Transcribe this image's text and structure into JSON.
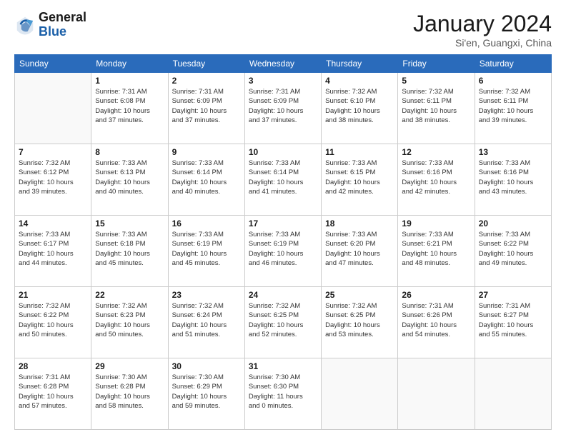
{
  "header": {
    "logo_general": "General",
    "logo_blue": "Blue",
    "title": "January 2024",
    "location": "Si'en, Guangxi, China"
  },
  "days_of_week": [
    "Sunday",
    "Monday",
    "Tuesday",
    "Wednesday",
    "Thursday",
    "Friday",
    "Saturday"
  ],
  "weeks": [
    [
      {
        "day": "",
        "info": ""
      },
      {
        "day": "1",
        "info": "Sunrise: 7:31 AM\nSunset: 6:08 PM\nDaylight: 10 hours\nand 37 minutes."
      },
      {
        "day": "2",
        "info": "Sunrise: 7:31 AM\nSunset: 6:09 PM\nDaylight: 10 hours\nand 37 minutes."
      },
      {
        "day": "3",
        "info": "Sunrise: 7:31 AM\nSunset: 6:09 PM\nDaylight: 10 hours\nand 37 minutes."
      },
      {
        "day": "4",
        "info": "Sunrise: 7:32 AM\nSunset: 6:10 PM\nDaylight: 10 hours\nand 38 minutes."
      },
      {
        "day": "5",
        "info": "Sunrise: 7:32 AM\nSunset: 6:11 PM\nDaylight: 10 hours\nand 38 minutes."
      },
      {
        "day": "6",
        "info": "Sunrise: 7:32 AM\nSunset: 6:11 PM\nDaylight: 10 hours\nand 39 minutes."
      }
    ],
    [
      {
        "day": "7",
        "info": "Sunrise: 7:32 AM\nSunset: 6:12 PM\nDaylight: 10 hours\nand 39 minutes."
      },
      {
        "day": "8",
        "info": "Sunrise: 7:33 AM\nSunset: 6:13 PM\nDaylight: 10 hours\nand 40 minutes."
      },
      {
        "day": "9",
        "info": "Sunrise: 7:33 AM\nSunset: 6:14 PM\nDaylight: 10 hours\nand 40 minutes."
      },
      {
        "day": "10",
        "info": "Sunrise: 7:33 AM\nSunset: 6:14 PM\nDaylight: 10 hours\nand 41 minutes."
      },
      {
        "day": "11",
        "info": "Sunrise: 7:33 AM\nSunset: 6:15 PM\nDaylight: 10 hours\nand 42 minutes."
      },
      {
        "day": "12",
        "info": "Sunrise: 7:33 AM\nSunset: 6:16 PM\nDaylight: 10 hours\nand 42 minutes."
      },
      {
        "day": "13",
        "info": "Sunrise: 7:33 AM\nSunset: 6:16 PM\nDaylight: 10 hours\nand 43 minutes."
      }
    ],
    [
      {
        "day": "14",
        "info": "Sunrise: 7:33 AM\nSunset: 6:17 PM\nDaylight: 10 hours\nand 44 minutes."
      },
      {
        "day": "15",
        "info": "Sunrise: 7:33 AM\nSunset: 6:18 PM\nDaylight: 10 hours\nand 45 minutes."
      },
      {
        "day": "16",
        "info": "Sunrise: 7:33 AM\nSunset: 6:19 PM\nDaylight: 10 hours\nand 45 minutes."
      },
      {
        "day": "17",
        "info": "Sunrise: 7:33 AM\nSunset: 6:19 PM\nDaylight: 10 hours\nand 46 minutes."
      },
      {
        "day": "18",
        "info": "Sunrise: 7:33 AM\nSunset: 6:20 PM\nDaylight: 10 hours\nand 47 minutes."
      },
      {
        "day": "19",
        "info": "Sunrise: 7:33 AM\nSunset: 6:21 PM\nDaylight: 10 hours\nand 48 minutes."
      },
      {
        "day": "20",
        "info": "Sunrise: 7:33 AM\nSunset: 6:22 PM\nDaylight: 10 hours\nand 49 minutes."
      }
    ],
    [
      {
        "day": "21",
        "info": "Sunrise: 7:32 AM\nSunset: 6:22 PM\nDaylight: 10 hours\nand 50 minutes."
      },
      {
        "day": "22",
        "info": "Sunrise: 7:32 AM\nSunset: 6:23 PM\nDaylight: 10 hours\nand 50 minutes."
      },
      {
        "day": "23",
        "info": "Sunrise: 7:32 AM\nSunset: 6:24 PM\nDaylight: 10 hours\nand 51 minutes."
      },
      {
        "day": "24",
        "info": "Sunrise: 7:32 AM\nSunset: 6:25 PM\nDaylight: 10 hours\nand 52 minutes."
      },
      {
        "day": "25",
        "info": "Sunrise: 7:32 AM\nSunset: 6:25 PM\nDaylight: 10 hours\nand 53 minutes."
      },
      {
        "day": "26",
        "info": "Sunrise: 7:31 AM\nSunset: 6:26 PM\nDaylight: 10 hours\nand 54 minutes."
      },
      {
        "day": "27",
        "info": "Sunrise: 7:31 AM\nSunset: 6:27 PM\nDaylight: 10 hours\nand 55 minutes."
      }
    ],
    [
      {
        "day": "28",
        "info": "Sunrise: 7:31 AM\nSunset: 6:28 PM\nDaylight: 10 hours\nand 57 minutes."
      },
      {
        "day": "29",
        "info": "Sunrise: 7:30 AM\nSunset: 6:28 PM\nDaylight: 10 hours\nand 58 minutes."
      },
      {
        "day": "30",
        "info": "Sunrise: 7:30 AM\nSunset: 6:29 PM\nDaylight: 10 hours\nand 59 minutes."
      },
      {
        "day": "31",
        "info": "Sunrise: 7:30 AM\nSunset: 6:30 PM\nDaylight: 11 hours\nand 0 minutes."
      },
      {
        "day": "",
        "info": ""
      },
      {
        "day": "",
        "info": ""
      },
      {
        "day": "",
        "info": ""
      }
    ]
  ]
}
